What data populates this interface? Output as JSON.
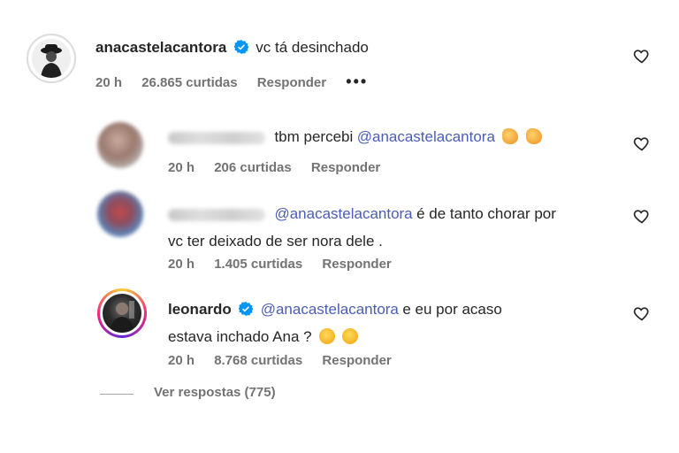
{
  "main_comment": {
    "username": "anacastelacantora",
    "text": "vc tá desinchado",
    "time": "20 h",
    "likes": "26.865 curtidas",
    "reply": "Responder",
    "more": "•••"
  },
  "replies": [
    {
      "username_hidden": true,
      "mention": "",
      "text": "tbm percebi",
      "mention_after": "@anacastelacantora",
      "emoji": [
        "clapping-hands",
        "clapping-hands"
      ],
      "time": "20 h",
      "likes": "206 curtidas",
      "reply": "Responder"
    },
    {
      "username_hidden": true,
      "mention": "@anacastelacantora",
      "text_line1": "é de tanto chorar por",
      "text_line2": "vc ter deixado de ser nora dele .",
      "time": "20 h",
      "likes": "1.405 curtidas",
      "reply": "Responder"
    },
    {
      "username": "leonardo",
      "mention": "@anacastelacantora",
      "text_line1": "e eu por acaso",
      "text_line2": "estava inchado Ana ?",
      "emoji": [
        "face-screaming",
        "laughing-face"
      ],
      "time": "20 h",
      "likes": "8.768 curtidas",
      "reply": "Responder"
    }
  ],
  "view_replies": "Ver respostas (775)",
  "colors": {
    "mention": "#4a5db7",
    "verified": "#0095f6",
    "meta": "#737373"
  }
}
